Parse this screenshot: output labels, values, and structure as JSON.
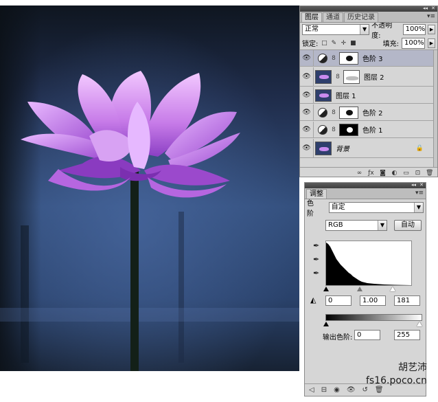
{
  "layers_panel": {
    "tabs": [
      "图层",
      "通道",
      "历史记录"
    ],
    "blend_mode": "正常",
    "opacity_label": "不透明度:",
    "opacity_value": "100%",
    "lock_label": "锁定:",
    "fill_label": "填充:",
    "fill_value": "100%",
    "layers": [
      {
        "name": "色阶 3",
        "type": "adjustment",
        "selected": true
      },
      {
        "name": "图层 2",
        "type": "layer-with-mask",
        "selected": false
      },
      {
        "name": "图层 1",
        "type": "layer",
        "selected": false
      },
      {
        "name": "色阶 2",
        "type": "adjustment",
        "selected": false
      },
      {
        "name": "色阶 1",
        "type": "adjustment",
        "selected": false
      },
      {
        "name": "背景",
        "type": "background",
        "selected": false
      }
    ]
  },
  "adjust_panel": {
    "tab": "调整",
    "type_label": "色阶",
    "preset_value": "自定",
    "channel_value": "RGB",
    "auto_label": "自动",
    "input_black": "0",
    "input_gamma": "1.00",
    "input_white": "181",
    "output_label": "输出色阶:",
    "output_black": "0",
    "output_white": "255"
  },
  "watermark": {
    "name": "胡艺沛",
    "url": "fs16.poco.cn"
  },
  "colors": {
    "panel_bg": "#d6d6d6",
    "selected_row": "#b4b7c8",
    "lotus_petal": "#c77be8",
    "photo_bg": "#2c3f66"
  }
}
